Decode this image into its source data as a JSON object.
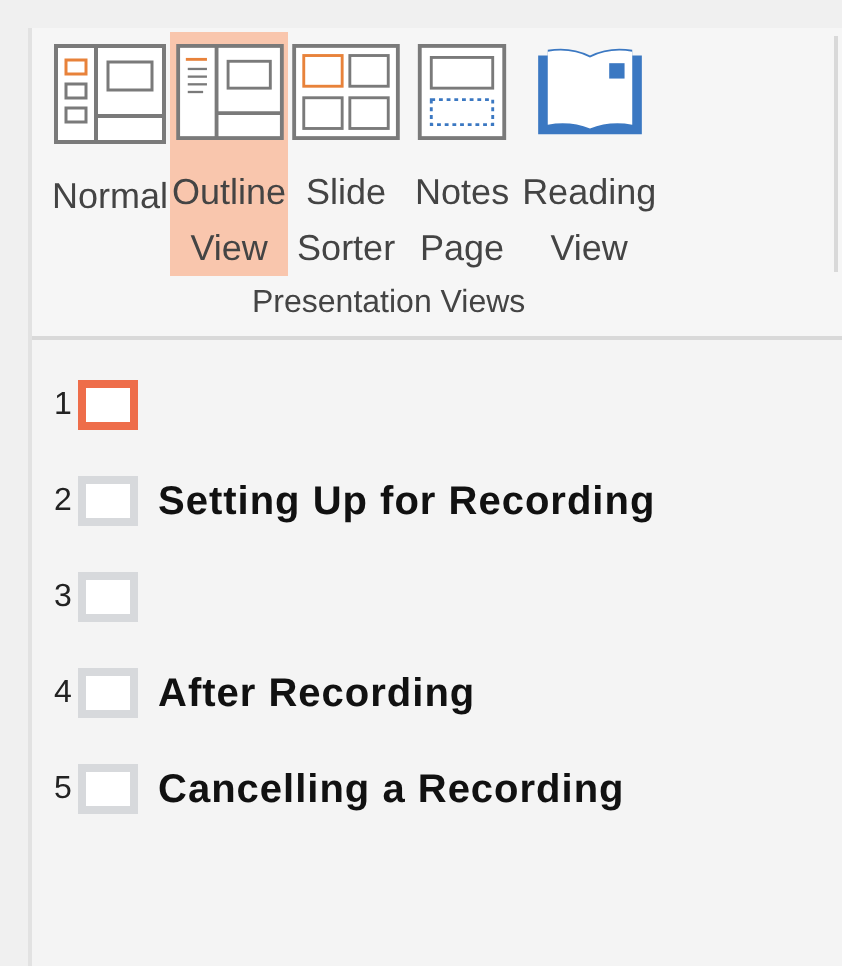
{
  "ribbon": {
    "buttons": [
      {
        "kind": "normal",
        "line1": "Normal",
        "selected": false
      },
      {
        "kind": "outline",
        "line1": "Outline",
        "line2": "View",
        "selected": true
      },
      {
        "kind": "sorter",
        "line1": "Slide",
        "line2": "Sorter",
        "selected": false
      },
      {
        "kind": "notes",
        "line1": "Notes",
        "line2": "Page",
        "selected": false
      },
      {
        "kind": "reading",
        "line1": "Reading",
        "line2": "View",
        "selected": false
      }
    ],
    "group_label": "Presentation Views"
  },
  "outline": [
    {
      "number": "1",
      "selected": true
    },
    {
      "number": "2",
      "title": "Setting Up for Recording",
      "selected": false
    },
    {
      "number": "3",
      "selected": false
    },
    {
      "number": "4",
      "title": "After Recording",
      "selected": false
    },
    {
      "number": "5",
      "title": "Cancelling a Recording",
      "selected": false
    }
  ]
}
